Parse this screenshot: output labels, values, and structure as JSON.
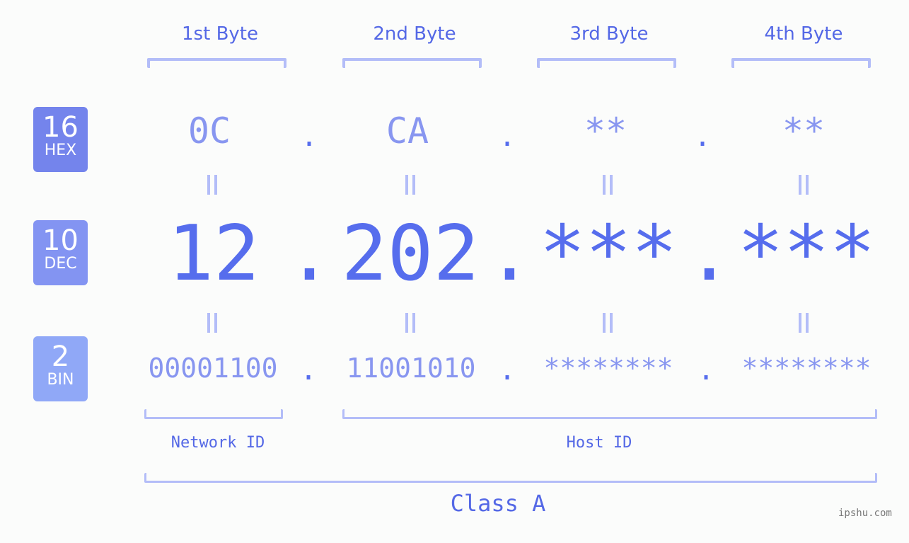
{
  "bytes": {
    "headers": [
      "1st Byte",
      "2nd Byte",
      "3rd Byte",
      "4th Byte"
    ]
  },
  "badges": {
    "hex": {
      "number": "16",
      "label": "HEX",
      "color": "#7484ec"
    },
    "dec": {
      "number": "10",
      "label": "DEC",
      "color": "#8394f2"
    },
    "bin": {
      "number": "2",
      "label": "BIN",
      "color": "#90a8f7"
    }
  },
  "hex_values": [
    "0C",
    "CA",
    "**",
    "**"
  ],
  "dec_values": [
    "12",
    "202",
    "***",
    "***"
  ],
  "bin_values": [
    "00001100",
    "11001010",
    "********",
    "********"
  ],
  "separator": ".",
  "segments": {
    "network_label": "Network ID",
    "host_label": "Host ID",
    "class_label": "Class A"
  },
  "watermark": "ipshu.com",
  "colors": {
    "accent": "#566ded",
    "light_accent": "#8896f0",
    "bracket": "#b3bdf8",
    "background": "#fbfcfb"
  }
}
